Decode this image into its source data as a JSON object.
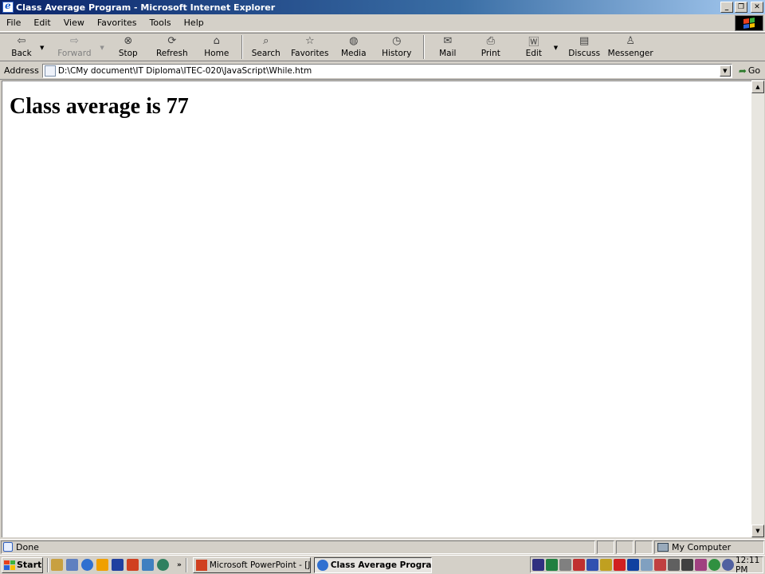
{
  "window": {
    "title": "Class Average Program - Microsoft Internet Explorer",
    "controls": {
      "minimize": "_",
      "maximize": "❐",
      "close": "✕"
    }
  },
  "menu": [
    "File",
    "Edit",
    "View",
    "Favorites",
    "Tools",
    "Help"
  ],
  "toolbar": {
    "back": "Back",
    "forward": "Forward",
    "stop": "Stop",
    "refresh": "Refresh",
    "home": "Home",
    "search": "Search",
    "favorites": "Favorites",
    "media": "Media",
    "history": "History",
    "mail": "Mail",
    "print": "Print",
    "edit": "Edit",
    "discuss": "Discuss",
    "messenger": "Messenger"
  },
  "address": {
    "label": "Address",
    "value": "D:\\CMy document\\IT Diploma\\ITEC-020\\JavaScript\\While.htm",
    "go": "Go"
  },
  "page": {
    "heading": "Class average is 77"
  },
  "status": {
    "text": "Done",
    "zone": "My Computer"
  },
  "taskbar": {
    "start": "Start",
    "quick_launch_more": "»",
    "tasks": [
      {
        "label": "Microsoft PowerPoint - [J...",
        "active": false
      },
      {
        "label": "Class Average Progra...",
        "active": true
      }
    ],
    "clock": "12:11 PM"
  },
  "colors": {
    "titlebar_start": "#0a246a",
    "titlebar_end": "#a6caf0",
    "chrome": "#d4d0c8"
  }
}
